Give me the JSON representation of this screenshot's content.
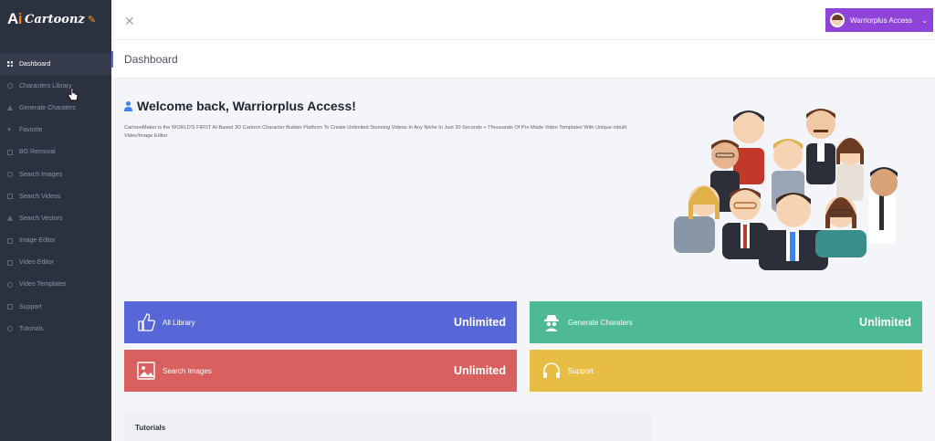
{
  "brand": {
    "prefix_a": "A",
    "prefix_i": "i",
    "name": "Cartoonz"
  },
  "sidebar": {
    "items": [
      {
        "label": "Dashboard",
        "icon": "grid-icon",
        "active": true
      },
      {
        "label": "Characters Library",
        "icon": "users-icon"
      },
      {
        "label": "Generate Charaters",
        "icon": "person-icon"
      },
      {
        "label": "Favorite",
        "icon": "heart-icon"
      },
      {
        "label": "BG Removal",
        "icon": "image-icon"
      },
      {
        "label": "Search Images",
        "icon": "search-icon"
      },
      {
        "label": "Search Videos",
        "icon": "video-icon"
      },
      {
        "label": "Search Vectors",
        "icon": "pen-icon"
      },
      {
        "label": "Image Editor",
        "icon": "image-edit-icon"
      },
      {
        "label": "Video Editor",
        "icon": "film-icon"
      },
      {
        "label": "Video Templates",
        "icon": "template-icon"
      },
      {
        "label": "Support",
        "icon": "chat-icon"
      },
      {
        "label": "Tutorials",
        "icon": "circle-play-icon"
      }
    ]
  },
  "topbar": {
    "close_icon": "close-icon",
    "user_name": "Warriorplus Access",
    "accent": "#8e44d8"
  },
  "header": {
    "title": "Dashboard"
  },
  "welcome": {
    "title": "Welcome back, Warriorplus Access!",
    "description": "CartoonMaker is the WORLD'S FIRST AI-Based 3D Cartoon Character Builder Platform To Create Unlimited Stunning Videos In Any Niche In Just 30 Seconds + Thousands Of Pre Made Video Templates With Unique inbuilt Video/Image Editor"
  },
  "cards": [
    {
      "label": "All Library",
      "value": "Unlimited",
      "icon": "thumbs-up-icon",
      "color": "#5867d8"
    },
    {
      "label": "Generate Charaters",
      "value": "Unlimited",
      "icon": "spy-icon",
      "color": "#4db995"
    },
    {
      "label": "Search Images",
      "value": "Unlimited",
      "icon": "image-icon",
      "color": "#d9605f"
    },
    {
      "label": "Support",
      "value": "",
      "icon": "headphones-icon",
      "color": "#e8bd43"
    }
  ],
  "tutorials": {
    "title": "Tutorials"
  }
}
